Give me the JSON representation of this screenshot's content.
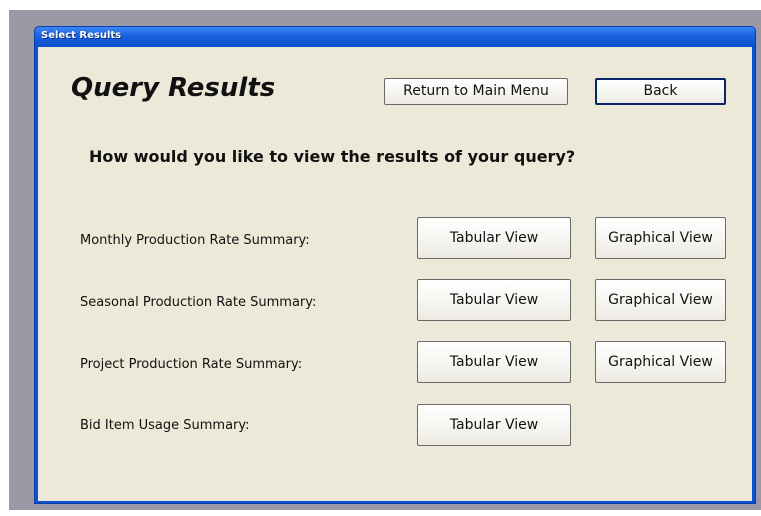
{
  "window": {
    "title": "Select Results"
  },
  "header": {
    "heading": "Query Results",
    "return_label": "Return to Main Menu",
    "back_label": "Back"
  },
  "prompt": "How would you like to view the results of your query?",
  "rows": [
    {
      "label": "Monthly Production Rate Summary:",
      "tabular_label": "Tabular View",
      "graphical_label": "Graphical View"
    },
    {
      "label": "Seasonal Production Rate Summary:",
      "tabular_label": "Tabular View",
      "graphical_label": "Graphical View"
    },
    {
      "label": "Project Production Rate Summary:",
      "tabular_label": "Tabular View",
      "graphical_label": "Graphical View"
    },
    {
      "label": "Bid Item Usage Summary:",
      "tabular_label": "Tabular View"
    }
  ],
  "colors": {
    "titlebar": "#0c52cc",
    "client_background": "#ece9d8",
    "desktop": "#9a9aa6"
  }
}
